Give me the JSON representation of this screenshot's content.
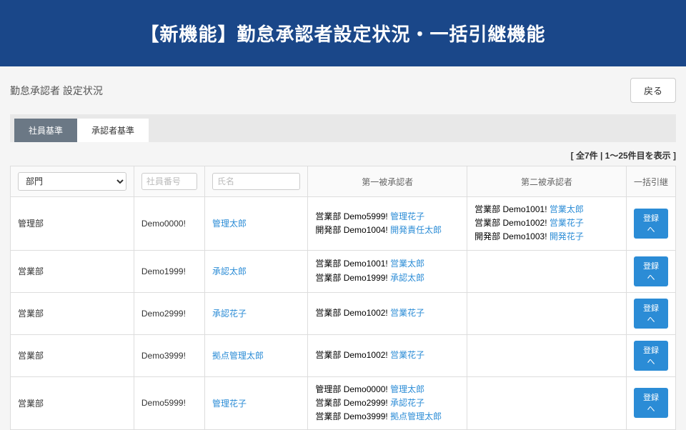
{
  "banner": {
    "title": "【新機能】勤怠承認者設定状況・一括引継機能"
  },
  "header": {
    "page_title": "勤怠承認者 設定状況",
    "back_label": "戻る"
  },
  "tabs": {
    "employee": "社員基準",
    "approver": "承認者基準"
  },
  "count": {
    "text": "[ 全7件 | 1〜25件目を表示 ]"
  },
  "table": {
    "headers": {
      "dept": "部門",
      "emp_no": "社員番号",
      "name": "氏名",
      "first_approver": "第一被承認者",
      "second_approver": "第二被承認者",
      "batch": "一括引継"
    },
    "filters": {
      "dept_placeholder": "部門",
      "emp_no_placeholder": "社員番号",
      "name_placeholder": "氏名"
    },
    "register_label": "登録へ",
    "rows": [
      {
        "dept": "管理部",
        "emp_no": "Demo0000!",
        "name": "管理太郎",
        "first": [
          {
            "prefix": "営業部 Demo5999! ",
            "link": "管理花子"
          },
          {
            "prefix": "開発部 Demo1004! ",
            "link": "開発責任太郎"
          }
        ],
        "second": [
          {
            "prefix": "営業部 Demo1001! ",
            "link": "営業太郎"
          },
          {
            "prefix": "営業部 Demo1002! ",
            "link": "営業花子"
          },
          {
            "prefix": "開発部 Demo1003! ",
            "link": "開発花子"
          }
        ]
      },
      {
        "dept": "営業部",
        "emp_no": "Demo1999!",
        "name": "承認太郎",
        "first": [
          {
            "prefix": "営業部 Demo1001! ",
            "link": "営業太郎"
          },
          {
            "prefix": "営業部 Demo1999! ",
            "link": "承認太郎"
          }
        ],
        "second": []
      },
      {
        "dept": "営業部",
        "emp_no": "Demo2999!",
        "name": "承認花子",
        "first": [
          {
            "prefix": "営業部 Demo1002! ",
            "link": "営業花子"
          }
        ],
        "second": []
      },
      {
        "dept": "営業部",
        "emp_no": "Demo3999!",
        "name": "拠点管理太郎",
        "first": [
          {
            "prefix": "営業部 Demo1002! ",
            "link": "営業花子"
          }
        ],
        "second": []
      },
      {
        "dept": "営業部",
        "emp_no": "Demo5999!",
        "name": "管理花子",
        "first": [
          {
            "prefix": "管理部 Demo0000! ",
            "link": "管理太郎"
          },
          {
            "prefix": "営業部 Demo2999! ",
            "link": "承認花子"
          },
          {
            "prefix": "営業部 Demo3999! ",
            "link": "拠点管理太郎"
          }
        ],
        "second": []
      }
    ]
  }
}
